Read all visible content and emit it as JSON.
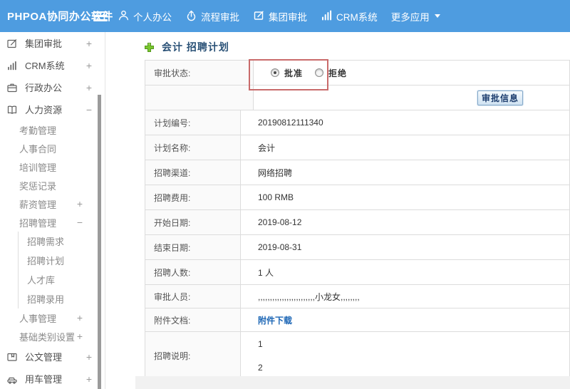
{
  "colors": {
    "topbar_bg": "#4e9ce0",
    "annotation_red": "#c96a6a",
    "link_blue": "#1c66b5",
    "title_navy": "#2b5277",
    "plus_green": "#79c62f",
    "label_cell_bg": "#fafafa",
    "table_border": "#dcdcdc"
  },
  "topbar": {
    "brand": "PHPOA协同办公软件",
    "nav": [
      {
        "label": "个人办公",
        "icon": "person-icon"
      },
      {
        "label": "流程审批",
        "icon": "process-icon"
      },
      {
        "label": "集团审批",
        "icon": "edit-square-icon"
      },
      {
        "label": "CRM系统",
        "icon": "bar-chart-icon"
      },
      {
        "label": "更多应用",
        "icon": "caret-down-icon"
      }
    ]
  },
  "sidebar": {
    "items": [
      {
        "label": "集团审批",
        "level": 1,
        "icon": "edit-square-icon",
        "expander": "+"
      },
      {
        "label": "CRM系统",
        "level": 1,
        "icon": "bar-chart-icon",
        "expander": "+"
      },
      {
        "label": "行政办公",
        "level": 1,
        "icon": "briefcase-icon",
        "expander": "+"
      },
      {
        "label": "人力资源",
        "level": 1,
        "icon": "book-icon",
        "expander": "−"
      },
      {
        "label": "考勤管理",
        "level": 2,
        "expander": ""
      },
      {
        "label": "人事合同",
        "level": 2,
        "expander": ""
      },
      {
        "label": "培训管理",
        "level": 2,
        "expander": ""
      },
      {
        "label": "奖惩记录",
        "level": 2,
        "expander": ""
      },
      {
        "label": "薪资管理",
        "level": 2,
        "expander": "+"
      },
      {
        "label": "招聘管理",
        "level": 2,
        "expander": "−"
      },
      {
        "label": "招聘需求",
        "level": 3,
        "expander": ""
      },
      {
        "label": "招聘计划",
        "level": 3,
        "expander": ""
      },
      {
        "label": "人才库",
        "level": 3,
        "expander": ""
      },
      {
        "label": "招聘录用",
        "level": 3,
        "expander": ""
      },
      {
        "label": "人事管理",
        "level": 2,
        "expander": "+"
      },
      {
        "label": "基础类别设置",
        "level": 2,
        "expander": "+"
      },
      {
        "label": "公文管理",
        "level": 1,
        "icon": "document-icon",
        "expander": "+"
      },
      {
        "label": "用车管理",
        "level": 1,
        "icon": "car-icon",
        "expander": "+"
      }
    ]
  },
  "main": {
    "page_title": "会计 招聘计划",
    "approval_status": {
      "label": "审批状态:",
      "options": [
        {
          "label": "批准",
          "selected": true
        },
        {
          "label": "拒绝",
          "selected": false
        }
      ]
    },
    "approval_info_button": "审批信息",
    "fields": [
      {
        "label": "计划编号:",
        "value": "20190812111340"
      },
      {
        "label": "计划名称:",
        "value": "会计"
      },
      {
        "label": "招聘渠道:",
        "value": "网络招聘"
      },
      {
        "label": "招聘费用:",
        "value": "100 RMB"
      },
      {
        "label": "开始日期:",
        "value": "2019-08-12"
      },
      {
        "label": "结束日期:",
        "value": "2019-08-31"
      },
      {
        "label": "招聘人数:",
        "value": "1 人"
      },
      {
        "label": "审批人员:",
        "value": ",,,,,,,,,,,,,,,,,,,,,,,,小龙女,,,,,,,,"
      },
      {
        "label": "附件文档:",
        "link": "附件下载"
      },
      {
        "label": "招聘说明:",
        "lines": [
          "1",
          "2"
        ]
      }
    ]
  }
}
